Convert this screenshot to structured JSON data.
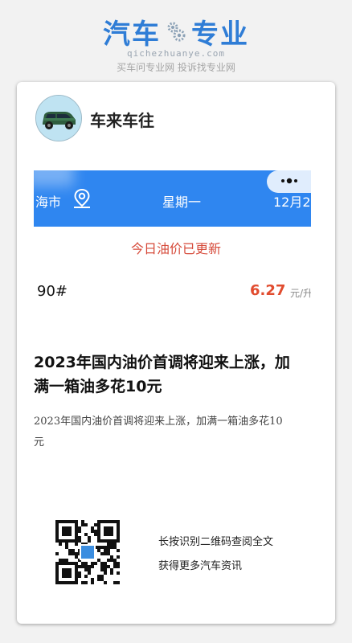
{
  "brand": {
    "title_left": "汽车",
    "title_right": "专业",
    "url": "qichezhuanye.com",
    "slogan": "买车问专业网 投诉找专业网",
    "color": "#2f7dd6"
  },
  "card": {
    "author": {
      "name": "车来车往",
      "avatar_icon": "car-avatar-icon"
    },
    "banner": {
      "city": "海市",
      "weekday": "星期一",
      "date": "12月2",
      "menu_icon": "more-dots-icon",
      "location_icon": "location-pin-icon",
      "color": "#2f86f0"
    },
    "notice": "今日油价已更新",
    "oil": {
      "grade": "90#",
      "price": "6.27",
      "unit": "元/升"
    },
    "headline": "2023年国内油价首调将迎来上涨，加满一箱油多花10元",
    "summary": "2023年国内油价首调将迎来上涨，加满一箱油多花10元",
    "qr": {
      "icon": "qr-code-icon",
      "line1": "长按识别二维码查阅全文",
      "line2": "获得更多汽车资讯"
    }
  }
}
